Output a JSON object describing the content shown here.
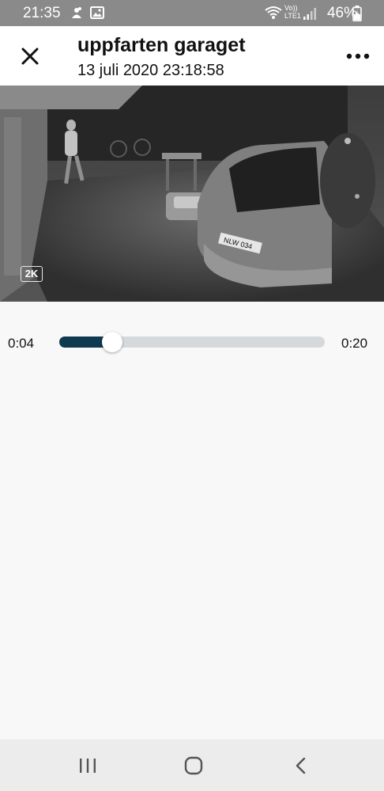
{
  "status_bar": {
    "time": "21:35",
    "battery": "46%",
    "network": "LTE1",
    "volte": "Vo))"
  },
  "header": {
    "title": "uppfarten garaget",
    "subtitle": "13 juli 2020 23:18:58",
    "close_icon": "close-icon",
    "more_icon": "more-horizontal-icon"
  },
  "video": {
    "resolution_badge": "2K",
    "plate_text": "NLW 034"
  },
  "player": {
    "current_time": "0:04",
    "total_time": "0:20",
    "progress": 0.2
  },
  "colors": {
    "progress_fill": "#0f3950",
    "track": "#d6d9dc",
    "status_bar": "#8a8a8a"
  },
  "navbar": {
    "recent_icon": "recent-apps-icon",
    "home_icon": "home-icon",
    "back_icon": "back-icon"
  }
}
